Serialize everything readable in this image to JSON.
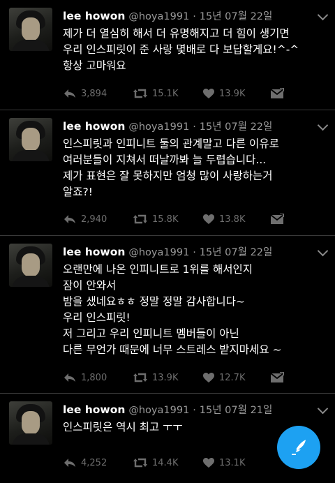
{
  "tweets": [
    {
      "name": "lee howon",
      "handle": "@hoya1991",
      "sep": "·",
      "date": "15년 07월 22일",
      "lines": [
        "제가 더 열심히 해서 더 유명해지고 더 힘이 생기면",
        "우리 인스피릿이 준 사랑 몇배로 다 보답할게요!^-^",
        "항상 고마워요"
      ],
      "replies": "3,894",
      "retweets": "15.1K",
      "likes": "13.9K"
    },
    {
      "name": "lee howon",
      "handle": "@hoya1991",
      "sep": "·",
      "date": "15년 07월 22일",
      "lines": [
        "인스피릿과 인피니트 둘의 관계말고 다른 이유로",
        "여러분들이 지쳐서 떠날까봐 늘 두렵습니다...",
        "제가 표현은 잘 못하지만 엄청 많이 사랑하는거",
        "알죠?!"
      ],
      "replies": "2,940",
      "retweets": "15.8K",
      "likes": "13.8K"
    },
    {
      "name": "lee howon",
      "handle": "@hoya1991",
      "sep": "·",
      "date": "15년 07월 22일",
      "lines": [
        "오랜만에 나온 인피니트로 1위를 해서인지",
        "잠이 안와서",
        "밤을 샜네요ㅎㅎ 정말 정말 감사합니다~",
        "우리 인스피릿!",
        "저 그리고 우리 인피니트 멤버들이 아닌",
        "다른 무언가 때문에 너무 스트레스 받지마세요 ~"
      ],
      "replies": "1,800",
      "retweets": "13.9K",
      "likes": "12.7K"
    },
    {
      "name": "lee howon",
      "handle": "@hoya1991",
      "sep": "·",
      "date": "15년 07월 21일",
      "lines": [
        "인스피릿은 역시 최고 ㅜㅜ"
      ],
      "replies": "4,252",
      "retweets": "14.4K",
      "likes": "13.1K"
    }
  ],
  "fab": {
    "icon": "compose-feather-icon",
    "color": "#1da1f2"
  }
}
